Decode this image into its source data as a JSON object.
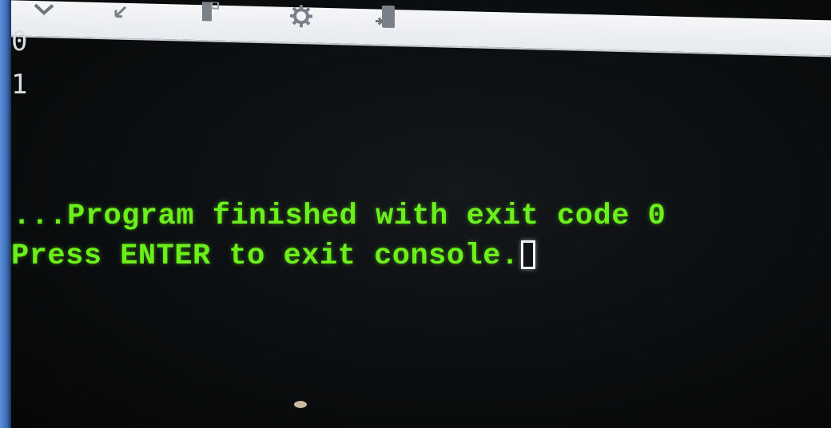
{
  "toolbar": {
    "icons": [
      "debug-icon",
      "step-icon",
      "stop-icon",
      "settings-icon",
      "save-icon"
    ]
  },
  "console": {
    "output_lines": [
      "0",
      "1"
    ],
    "finish_message": "...Program finished with exit code 0",
    "prompt_message": "Press ENTER to exit console."
  },
  "colors": {
    "terminal_background": "#0b0e10",
    "message_green": "#6cf01a",
    "output_text": "#d9dde0",
    "toolbar": "#eef0f3"
  }
}
